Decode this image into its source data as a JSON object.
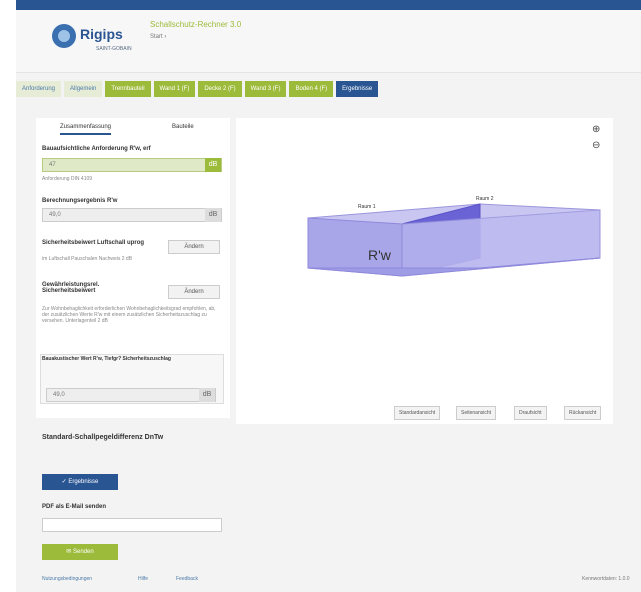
{
  "header": {
    "logo_text": "Rigips",
    "logo_sub": "SAINT-GOBAIN",
    "app_title": "Schallschutz-Rechner 3.0",
    "app_subtitle": "Start ›"
  },
  "tabs": [
    {
      "label": "Anforderung",
      "style": "light"
    },
    {
      "label": "Allgemein",
      "style": "light"
    },
    {
      "label": "Trennbauteil",
      "style": "green"
    },
    {
      "label": "Wand 1 (F)",
      "style": "green"
    },
    {
      "label": "Decke 2 (F)",
      "style": "green"
    },
    {
      "label": "Wand 3 (F)",
      "style": "green"
    },
    {
      "label": "Boden 4 (F)",
      "style": "green"
    },
    {
      "label": "Ergebnisse",
      "style": "blue"
    }
  ],
  "subtabs": {
    "left": "Zusammenfassung",
    "right": "Bauteile"
  },
  "form": {
    "req_label": "Bauaufsichtliche Anforderung R'w, erf",
    "req_value": "47",
    "req_note": "Anforderung DIN 4109",
    "calc_label": "Berechnungsergebnis R'w",
    "calc_value": "49,0",
    "safety_label": "Sicherheitsbeiwert Luftschall uprog",
    "safety_button": "Ändern",
    "safety_note": "im Luftschall Pauschalen Nachweis 2 dB",
    "extra_label": "Gewährleistungsrel. Sicherheitsbeiwert",
    "extra_button": "Ändern",
    "extra_note": "Zur Wohnbehaglichkeit erforderlichen Wohnbehaglichkeitsgrad empfohlen, ab, der zusätzlichen Werte R'w mit einem zusätzlichen Sicherheitszuschlag zu versehen. Unterlagenteil 2 dB",
    "box_label": "Bauakustischer Wert R'w, Tiefgr? Sicherheitszuschlag",
    "box_value": "49,0"
  },
  "viewer": {
    "room1_label": "Raum 1",
    "room2_label": "Raum 2",
    "marker": "R'w",
    "buttons": [
      "Standardansicht",
      "Seitenansicht",
      "Draufsicht",
      "Rückansicht"
    ],
    "zoom_in_icon": "zoom-in-icon",
    "zoom_out_icon": "zoom-out-icon"
  },
  "section": {
    "title": "Standard-Schallpegeldifferenz DnTw",
    "result_button": "✓ Ergebnisse",
    "pdf_label": "PDF als E-Mail senden",
    "send_button": "✉ Senden"
  },
  "footer": {
    "links": [
      "Nutzungsbedingungen",
      "Hilfe",
      "Feedback"
    ],
    "version": "Kennwortdaten: 1.0.0"
  },
  "colors": {
    "accent_blue": "#2a5593",
    "accent_green": "#9dbb3a",
    "room_fill": "#a8a5e8",
    "partition_fill": "#6a63d6"
  }
}
